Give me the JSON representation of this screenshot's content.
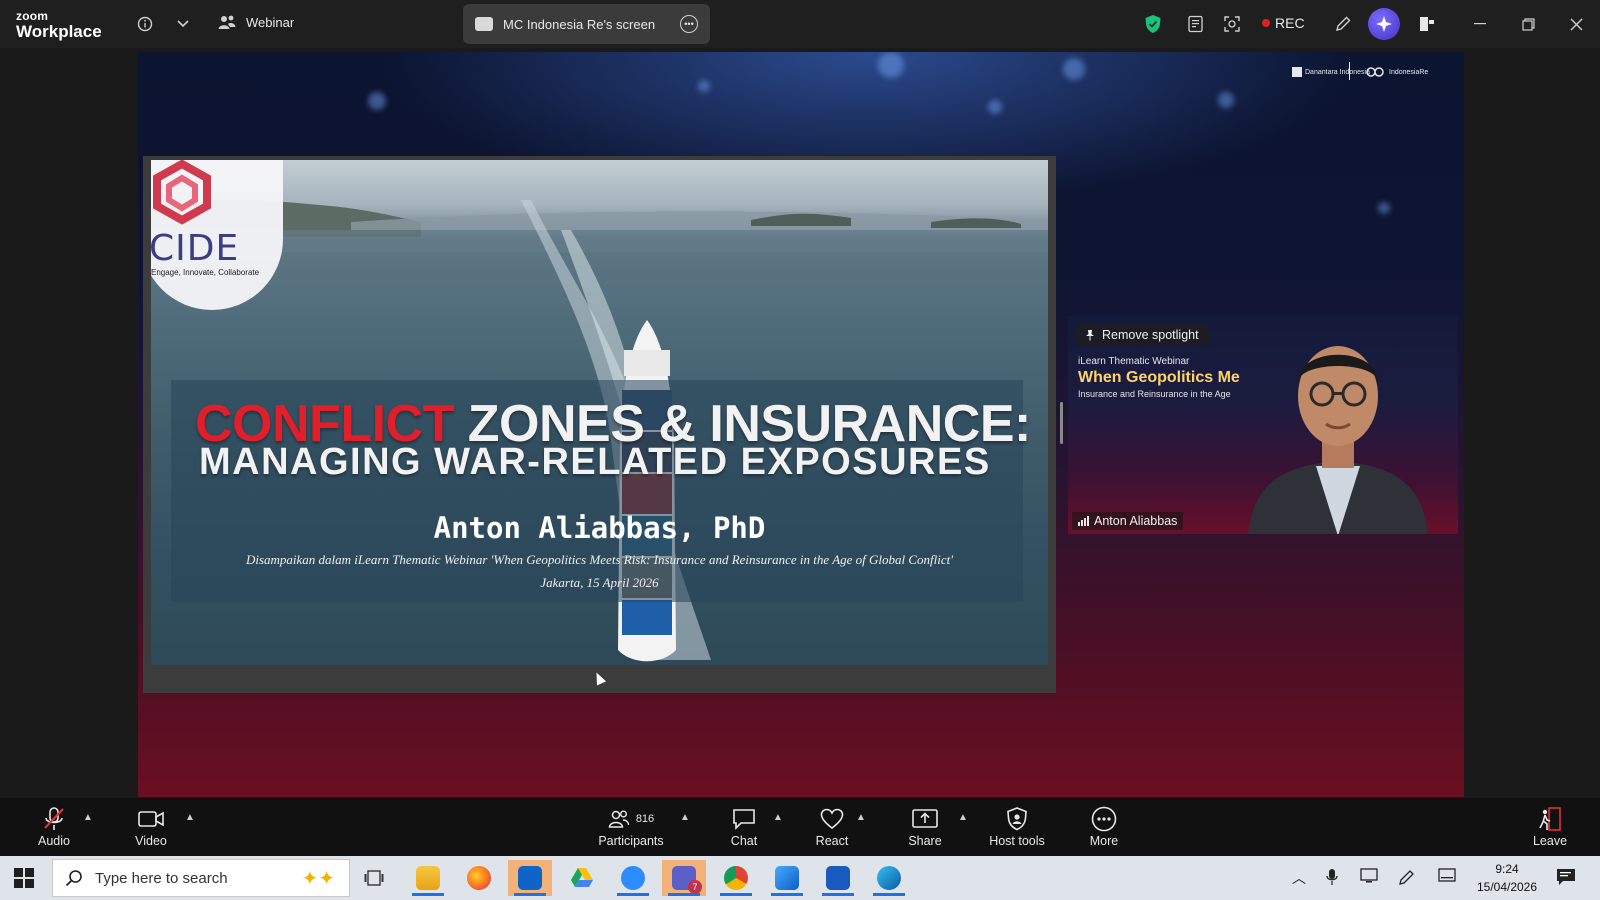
{
  "app": {
    "brand_line1": "zoom",
    "brand_line2": "Workplace",
    "mode_label": "Webinar",
    "share_title": "MC Indonesia Re's screen",
    "rec_label": "REC"
  },
  "stage": {
    "sponsor_1": "Danantara Indonesia",
    "sponsor_2": "IndonesiaRe"
  },
  "slide": {
    "logo_text": "CIDE",
    "logo_tagline": "Engage, Innovate, Collaborate",
    "title_red": "CONFLICT",
    "title_white": " ZONES & INSURANCE:",
    "title_line2": "MANAGING WAR-RELATED EXPOSURES",
    "speaker": "Anton Aliabbas, PhD",
    "caption_1": "Disampaikan dalam iLearn Thematic Webinar 'When Geopolitics Meets Risk: Insurance and Reinsurance in the Age of Global Conflict'",
    "caption_2": "Jakarta, 15 April 2026"
  },
  "spotlight": {
    "remove_label": "Remove spotlight",
    "line1": "iLearn Thematic Webinar",
    "line2": "When Geopolitics Me",
    "line3": "Insurance and Reinsurance in the Age",
    "name": "Anton Aliabbas"
  },
  "toolbar": {
    "audio": "Audio",
    "video": "Video",
    "participants": "Participants",
    "participant_count": "816",
    "chat": "Chat",
    "react": "React",
    "share": "Share",
    "host_tools": "Host tools",
    "more": "More",
    "leave": "Leave"
  },
  "taskbar": {
    "search_placeholder": "Type here to search",
    "time": "9:24",
    "date": "15/04/2026",
    "notification_count": "7"
  },
  "colors": {
    "accent_red": "#e01f2b",
    "ai_purple": "#5a45e0",
    "shield_green": "#19c37d",
    "toolbar_bg": "#111111"
  }
}
